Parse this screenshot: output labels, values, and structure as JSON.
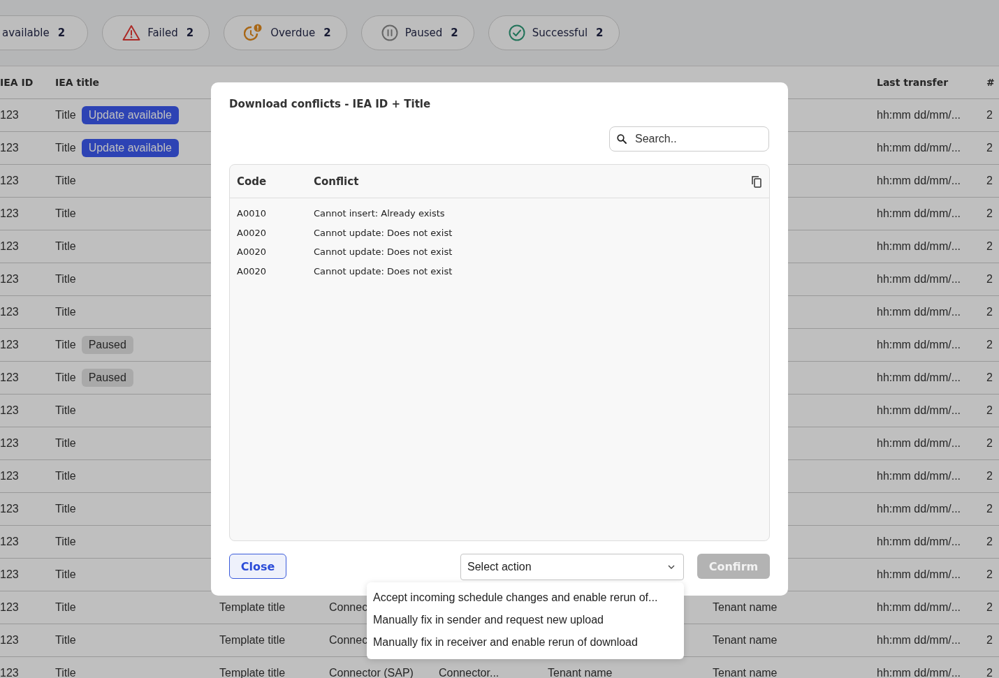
{
  "filters": [
    {
      "kind": "update",
      "label": "available",
      "count": "2"
    },
    {
      "kind": "failed",
      "label": "Failed",
      "count": "2"
    },
    {
      "kind": "overdue",
      "label": "Overdue",
      "count": "2"
    },
    {
      "kind": "paused",
      "label": "Paused",
      "count": "2"
    },
    {
      "kind": "successful",
      "label": "Successful",
      "count": "2"
    }
  ],
  "table": {
    "columns": {
      "id": "IEA ID",
      "title": "IEA title",
      "last_transfer": "Last transfer",
      "count": "#"
    },
    "rows": [
      {
        "id": "123",
        "title": "Title",
        "badge": {
          "kind": "update",
          "text": "Update available"
        },
        "last_transfer": "hh:mm dd/mm/...",
        "count": "2"
      },
      {
        "id": "123",
        "title": "Title",
        "badge": {
          "kind": "update",
          "text": "Update available"
        },
        "last_transfer": "hh:mm dd/mm/...",
        "count": "2"
      },
      {
        "id": "123",
        "title": "Title",
        "last_transfer": "hh:mm dd/mm/...",
        "count": "2"
      },
      {
        "id": "123",
        "title": "Title",
        "last_transfer": "hh:mm dd/mm/...",
        "count": "2"
      },
      {
        "id": "123",
        "title": "Title",
        "last_transfer": "hh:mm dd/mm/...",
        "count": "2"
      },
      {
        "id": "123",
        "title": "Title",
        "last_transfer": "hh:mm dd/mm/...",
        "count": "2"
      },
      {
        "id": "123",
        "title": "Title",
        "last_transfer": "hh:mm dd/mm/...",
        "count": "2"
      },
      {
        "id": "123",
        "title": "Title",
        "badge": {
          "kind": "paused",
          "text": "Paused"
        },
        "last_transfer": "hh:mm dd/mm/...",
        "count": "2"
      },
      {
        "id": "123",
        "title": "Title",
        "badge": {
          "kind": "paused",
          "text": "Paused"
        },
        "last_transfer": "hh:mm dd/mm/...",
        "count": "2"
      },
      {
        "id": "123",
        "title": "Title",
        "last_transfer": "hh:mm dd/mm/...",
        "count": "2"
      },
      {
        "id": "123",
        "title": "Title",
        "last_transfer": "hh:mm dd/mm/...",
        "count": "2"
      },
      {
        "id": "123",
        "title": "Title",
        "last_transfer": "hh:mm dd/mm/...",
        "count": "2"
      },
      {
        "id": "123",
        "title": "Title",
        "last_transfer": "hh:mm dd/mm/...",
        "count": "2"
      },
      {
        "id": "123",
        "title": "Title",
        "last_transfer": "hh:mm dd/mm/...",
        "count": "2"
      },
      {
        "id": "123",
        "title": "Title",
        "last_transfer": "hh:mm dd/mm/...",
        "count": "2"
      },
      {
        "id": "123",
        "title": "Title",
        "template": "Template title",
        "sending": "Connec",
        "receiver": "Tenant name",
        "last_transfer": "hh:mm dd/mm/...",
        "count": "2"
      },
      {
        "id": "123",
        "title": "Title",
        "template": "Template title",
        "sending": "Connec",
        "receiver": "Tenant name",
        "last_transfer": "hh:mm dd/mm/...",
        "count": "2"
      },
      {
        "id": "123",
        "title": "Title",
        "template": "Template title",
        "sending": "Connector (SAP)",
        "receiving": "Connector...",
        "sender": "Tenant name",
        "receiver": "Tenant name",
        "last_transfer": "hh:mm dd/mm/...",
        "count": "2"
      }
    ]
  },
  "dialog": {
    "title": "Download conflicts - IEA ID + Title",
    "search": {
      "placeholder": "Search.."
    },
    "columns": [
      "Code",
      "Conflict"
    ],
    "rows": [
      {
        "code": "A0010",
        "conflict": "Cannot insert: Already exists"
      },
      {
        "code": "A0020",
        "conflict": "Cannot update: Does not exist"
      },
      {
        "code": "A0020",
        "conflict": "Cannot update: Does not exist"
      },
      {
        "code": "A0020",
        "conflict": "Cannot update: Does not exist"
      }
    ],
    "close_button": "Close",
    "action_select": {
      "placeholder": "Select action",
      "expanded": true,
      "options": [
        "Accept incoming schedule changes and enable rerun of...",
        "Manually fix in sender and request new upload",
        "Manually fix in receiver and enable rerun of download"
      ]
    },
    "confirm_button": {
      "label": "Confirm",
      "disabled": true
    }
  }
}
